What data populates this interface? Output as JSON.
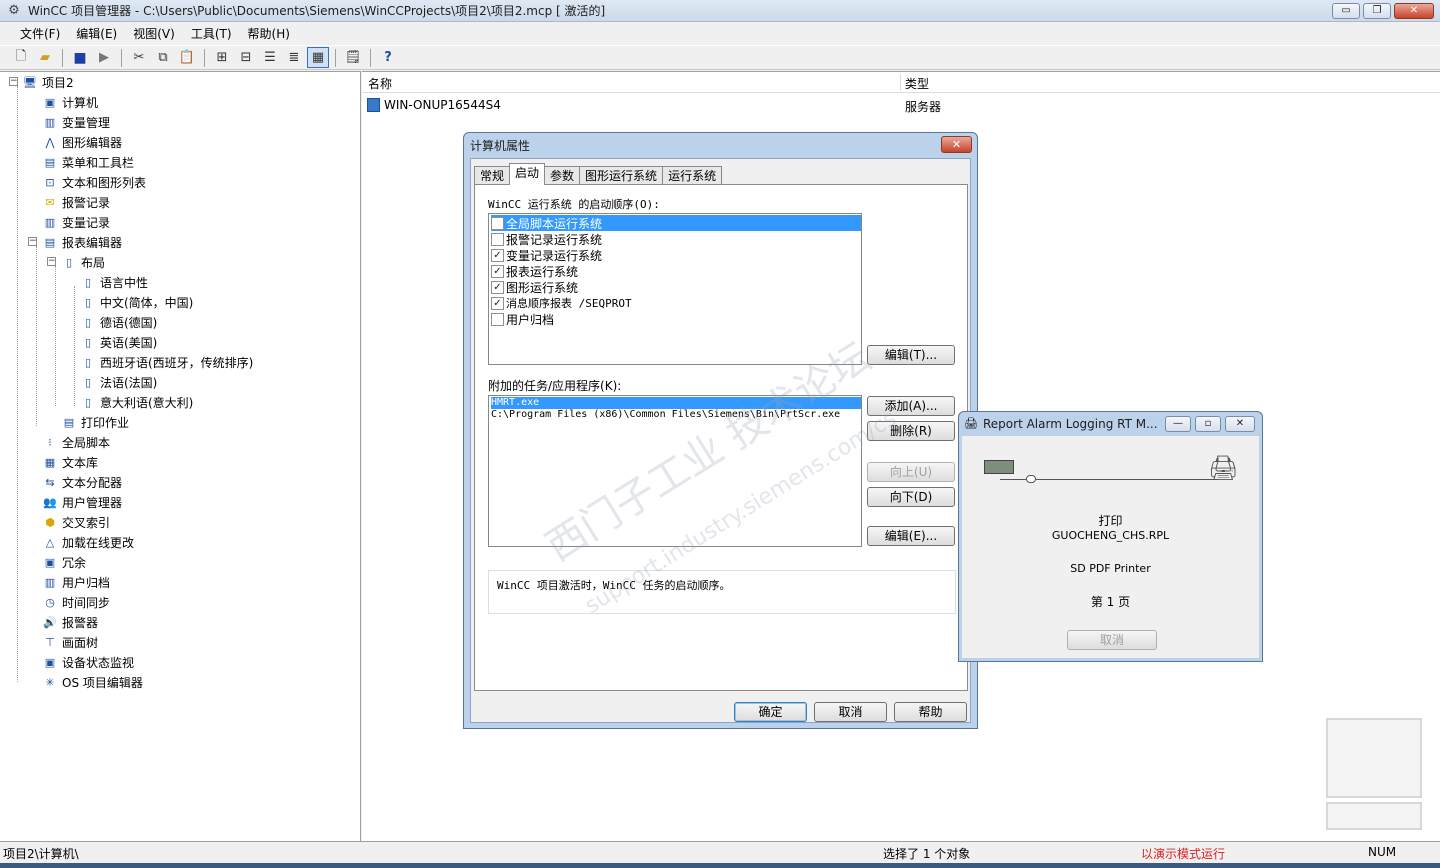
{
  "window": {
    "title": "WinCC 项目管理器 - C:\\Users\\Public\\Documents\\Siemens\\WinCCProjects\\项目2\\项目2.mcp [ 激活的]",
    "minimize": "▭",
    "restore": "❐",
    "close": "✕"
  },
  "menu": [
    "文件(F)",
    "编辑(E)",
    "视图(V)",
    "工具(T)",
    "帮助(H)"
  ],
  "toolbar": {
    "icons": [
      "new-icon",
      "open-icon",
      "stop-icon",
      "run-icon",
      "cut-icon",
      "copy-icon",
      "paste-icon",
      "large-icons-icon",
      "small-icons-icon",
      "list-icon",
      "details-icon",
      "grid-icon",
      "properties-icon",
      "help-icon"
    ],
    "help": "?"
  },
  "tree": {
    "root": "项目2",
    "items": [
      "计算机",
      "变量管理",
      "图形编辑器",
      "菜单和工具栏",
      "文本和图形列表",
      "报警记录",
      "变量记录",
      "报表编辑器"
    ],
    "layout": "布局",
    "languages": [
      "语言中性",
      "中文(简体，中国)",
      "德语(德国)",
      "英语(美国)",
      "西班牙语(西班牙，传统排序)",
      "法语(法国)",
      "意大利语(意大利)"
    ],
    "print_job": "打印作业",
    "more_items": [
      "全局脚本",
      "文本库",
      "文本分配器",
      "用户管理器",
      "交叉索引",
      "加载在线更改",
      "冗余",
      "用户归档",
      "时间同步",
      "报警器",
      "画面树",
      "设备状态监视",
      "OS 项目编辑器"
    ]
  },
  "list": {
    "col_name": "名称",
    "col_type": "类型",
    "rows": [
      {
        "name": "WIN-ONUP16544S4",
        "type": "服务器"
      }
    ]
  },
  "dialog": {
    "title": "计算机属性",
    "close": "✕",
    "tabs": [
      "常规",
      "启动",
      "参数",
      "图形运行系统",
      "运行系统"
    ],
    "selected_tab": "启动",
    "startup_label": "WinCC 运行系统 的启动顺序(O):",
    "startup_items": [
      {
        "label": "全局脚本运行系统",
        "checked": false,
        "selected": true
      },
      {
        "label": "报警记录运行系统",
        "checked": false,
        "selected": false
      },
      {
        "label": "变量记录运行系统",
        "checked": true,
        "selected": false
      },
      {
        "label": "报表运行系统",
        "checked": true,
        "selected": false
      },
      {
        "label": "图形运行系统",
        "checked": true,
        "selected": false
      },
      {
        "label": "消息顺序报表 /SEQPROT",
        "checked": true,
        "selected": false
      },
      {
        "label": "用户归档",
        "checked": false,
        "selected": false
      }
    ],
    "edit1": "编辑(T)...",
    "tasks_label": "附加的任务/应用程序(K):",
    "tasks": [
      {
        "label": "HMRT.exe",
        "selected": true
      },
      {
        "label": "C:\\Program Files (x86)\\Common Files\\Siemens\\Bin\\PrtScr.exe",
        "selected": false
      }
    ],
    "add": "添加(A)...",
    "delete": "删除(R)",
    "up": "向上(U)",
    "down": "向下(D)",
    "edit2": "编辑(E)...",
    "description": "WinCC 项目激活时，WinCC 任务的启动顺序。",
    "ok": "确定",
    "cancel": "取消",
    "help": "帮助"
  },
  "watermark": {
    "line1": "西门子工业 技术论坛",
    "line2": "support.industry.siemens.com/cs"
  },
  "report_window": {
    "title": "Report Alarm Logging RT M...",
    "printing": "打印",
    "file": "GUOCHENG_CHS.RPL",
    "printer": "SD PDF Printer",
    "page": "第 1 页",
    "cancel": "取消"
  },
  "status": {
    "path": "项目2\\计算机\\",
    "selection": "选择了 1 个对象",
    "demo_mode": "以演示模式运行",
    "num": "NUM"
  },
  "colors": {
    "selection": "#3399ff",
    "demo_mode": "#e02020",
    "dialog_frame": "#bcd1ea"
  }
}
